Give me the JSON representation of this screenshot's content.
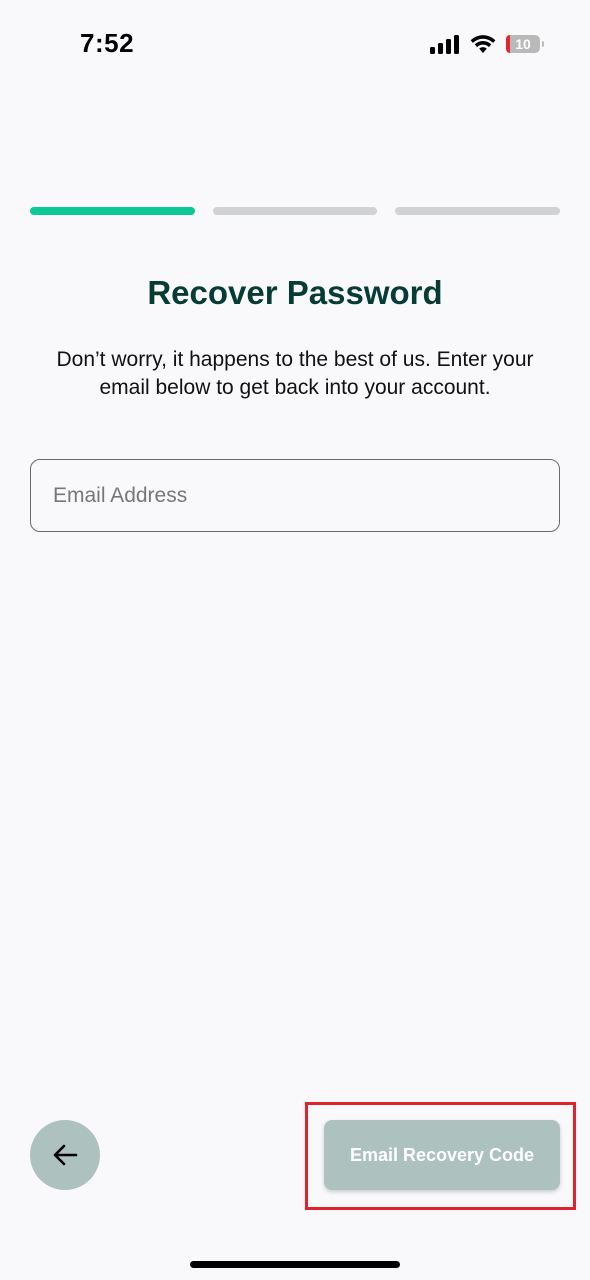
{
  "status_bar": {
    "time": "7:52",
    "battery_level": "10"
  },
  "progress": {
    "total_steps": 3,
    "current_step": 1,
    "active_color": "#0cc995",
    "inactive_color": "#d1d2d4"
  },
  "page": {
    "title": "Recover Password",
    "subtitle": "Don’t worry, it happens to the best of us. Enter your email below to get back into your account.",
    "title_color": "#073c36"
  },
  "form": {
    "email_placeholder": "Email Address",
    "email_value": ""
  },
  "actions": {
    "back_icon": "arrow-left-icon",
    "submit_label": "Email Recovery Code",
    "button_color": "#adc1bf",
    "highlight_color": "#e0222c"
  }
}
